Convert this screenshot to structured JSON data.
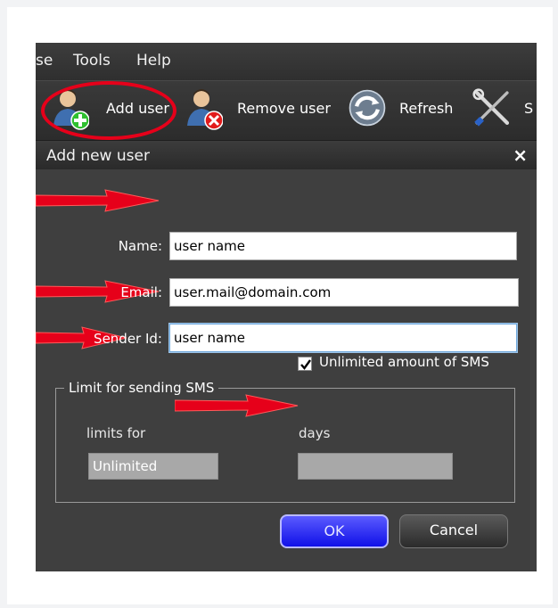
{
  "menubar": {
    "items": [
      {
        "label": "se"
      },
      {
        "label": "Tools"
      },
      {
        "label": "Help"
      }
    ]
  },
  "toolbar": {
    "add_user_label": "Add user",
    "remove_user_label": "Remove user",
    "refresh_label": "Refresh",
    "settings_label": "S"
  },
  "dialog": {
    "title": "Add new user",
    "close_glyph": "×",
    "fields": {
      "name": {
        "label": "Name:",
        "value": "user name"
      },
      "email": {
        "label": "Email:",
        "value": "user.mail@domain.com"
      },
      "sender_id": {
        "label": "Sender Id:",
        "value": "user name"
      }
    },
    "unlimited_checkbox": {
      "label": "Unlimited amount of SMS",
      "checked": true
    },
    "limit_group": {
      "title": "Limit for sending SMS",
      "limits_for_label": "limits for",
      "limits_for_value": "Unlimited",
      "days_label": "days",
      "days_value": ""
    },
    "ok_label": "OK",
    "cancel_label": "Cancel"
  },
  "colors": {
    "annotation_red": "#e6001a",
    "ok_blue": "#1010e8"
  }
}
